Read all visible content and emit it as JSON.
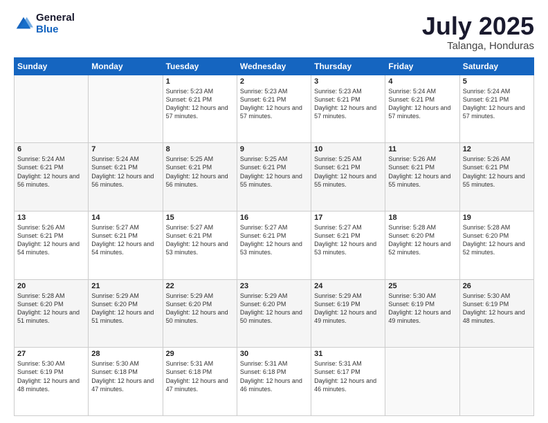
{
  "logo": {
    "general": "General",
    "blue": "Blue"
  },
  "title": "July 2025",
  "location": "Talanga, Honduras",
  "weekdays": [
    "Sunday",
    "Monday",
    "Tuesday",
    "Wednesday",
    "Thursday",
    "Friday",
    "Saturday"
  ],
  "weeks": [
    [
      {
        "day": "",
        "sunrise": "",
        "sunset": "",
        "daylight": ""
      },
      {
        "day": "",
        "sunrise": "",
        "sunset": "",
        "daylight": ""
      },
      {
        "day": "1",
        "sunrise": "Sunrise: 5:23 AM",
        "sunset": "Sunset: 6:21 PM",
        "daylight": "Daylight: 12 hours and 57 minutes."
      },
      {
        "day": "2",
        "sunrise": "Sunrise: 5:23 AM",
        "sunset": "Sunset: 6:21 PM",
        "daylight": "Daylight: 12 hours and 57 minutes."
      },
      {
        "day": "3",
        "sunrise": "Sunrise: 5:23 AM",
        "sunset": "Sunset: 6:21 PM",
        "daylight": "Daylight: 12 hours and 57 minutes."
      },
      {
        "day": "4",
        "sunrise": "Sunrise: 5:24 AM",
        "sunset": "Sunset: 6:21 PM",
        "daylight": "Daylight: 12 hours and 57 minutes."
      },
      {
        "day": "5",
        "sunrise": "Sunrise: 5:24 AM",
        "sunset": "Sunset: 6:21 PM",
        "daylight": "Daylight: 12 hours and 57 minutes."
      }
    ],
    [
      {
        "day": "6",
        "sunrise": "Sunrise: 5:24 AM",
        "sunset": "Sunset: 6:21 PM",
        "daylight": "Daylight: 12 hours and 56 minutes."
      },
      {
        "day": "7",
        "sunrise": "Sunrise: 5:24 AM",
        "sunset": "Sunset: 6:21 PM",
        "daylight": "Daylight: 12 hours and 56 minutes."
      },
      {
        "day": "8",
        "sunrise": "Sunrise: 5:25 AM",
        "sunset": "Sunset: 6:21 PM",
        "daylight": "Daylight: 12 hours and 56 minutes."
      },
      {
        "day": "9",
        "sunrise": "Sunrise: 5:25 AM",
        "sunset": "Sunset: 6:21 PM",
        "daylight": "Daylight: 12 hours and 55 minutes."
      },
      {
        "day": "10",
        "sunrise": "Sunrise: 5:25 AM",
        "sunset": "Sunset: 6:21 PM",
        "daylight": "Daylight: 12 hours and 55 minutes."
      },
      {
        "day": "11",
        "sunrise": "Sunrise: 5:26 AM",
        "sunset": "Sunset: 6:21 PM",
        "daylight": "Daylight: 12 hours and 55 minutes."
      },
      {
        "day": "12",
        "sunrise": "Sunrise: 5:26 AM",
        "sunset": "Sunset: 6:21 PM",
        "daylight": "Daylight: 12 hours and 55 minutes."
      }
    ],
    [
      {
        "day": "13",
        "sunrise": "Sunrise: 5:26 AM",
        "sunset": "Sunset: 6:21 PM",
        "daylight": "Daylight: 12 hours and 54 minutes."
      },
      {
        "day": "14",
        "sunrise": "Sunrise: 5:27 AM",
        "sunset": "Sunset: 6:21 PM",
        "daylight": "Daylight: 12 hours and 54 minutes."
      },
      {
        "day": "15",
        "sunrise": "Sunrise: 5:27 AM",
        "sunset": "Sunset: 6:21 PM",
        "daylight": "Daylight: 12 hours and 53 minutes."
      },
      {
        "day": "16",
        "sunrise": "Sunrise: 5:27 AM",
        "sunset": "Sunset: 6:21 PM",
        "daylight": "Daylight: 12 hours and 53 minutes."
      },
      {
        "day": "17",
        "sunrise": "Sunrise: 5:27 AM",
        "sunset": "Sunset: 6:21 PM",
        "daylight": "Daylight: 12 hours and 53 minutes."
      },
      {
        "day": "18",
        "sunrise": "Sunrise: 5:28 AM",
        "sunset": "Sunset: 6:20 PM",
        "daylight": "Daylight: 12 hours and 52 minutes."
      },
      {
        "day": "19",
        "sunrise": "Sunrise: 5:28 AM",
        "sunset": "Sunset: 6:20 PM",
        "daylight": "Daylight: 12 hours and 52 minutes."
      }
    ],
    [
      {
        "day": "20",
        "sunrise": "Sunrise: 5:28 AM",
        "sunset": "Sunset: 6:20 PM",
        "daylight": "Daylight: 12 hours and 51 minutes."
      },
      {
        "day": "21",
        "sunrise": "Sunrise: 5:29 AM",
        "sunset": "Sunset: 6:20 PM",
        "daylight": "Daylight: 12 hours and 51 minutes."
      },
      {
        "day": "22",
        "sunrise": "Sunrise: 5:29 AM",
        "sunset": "Sunset: 6:20 PM",
        "daylight": "Daylight: 12 hours and 50 minutes."
      },
      {
        "day": "23",
        "sunrise": "Sunrise: 5:29 AM",
        "sunset": "Sunset: 6:20 PM",
        "daylight": "Daylight: 12 hours and 50 minutes."
      },
      {
        "day": "24",
        "sunrise": "Sunrise: 5:29 AM",
        "sunset": "Sunset: 6:19 PM",
        "daylight": "Daylight: 12 hours and 49 minutes."
      },
      {
        "day": "25",
        "sunrise": "Sunrise: 5:30 AM",
        "sunset": "Sunset: 6:19 PM",
        "daylight": "Daylight: 12 hours and 49 minutes."
      },
      {
        "day": "26",
        "sunrise": "Sunrise: 5:30 AM",
        "sunset": "Sunset: 6:19 PM",
        "daylight": "Daylight: 12 hours and 48 minutes."
      }
    ],
    [
      {
        "day": "27",
        "sunrise": "Sunrise: 5:30 AM",
        "sunset": "Sunset: 6:19 PM",
        "daylight": "Daylight: 12 hours and 48 minutes."
      },
      {
        "day": "28",
        "sunrise": "Sunrise: 5:30 AM",
        "sunset": "Sunset: 6:18 PM",
        "daylight": "Daylight: 12 hours and 47 minutes."
      },
      {
        "day": "29",
        "sunrise": "Sunrise: 5:31 AM",
        "sunset": "Sunset: 6:18 PM",
        "daylight": "Daylight: 12 hours and 47 minutes."
      },
      {
        "day": "30",
        "sunrise": "Sunrise: 5:31 AM",
        "sunset": "Sunset: 6:18 PM",
        "daylight": "Daylight: 12 hours and 46 minutes."
      },
      {
        "day": "31",
        "sunrise": "Sunrise: 5:31 AM",
        "sunset": "Sunset: 6:17 PM",
        "daylight": "Daylight: 12 hours and 46 minutes."
      },
      {
        "day": "",
        "sunrise": "",
        "sunset": "",
        "daylight": ""
      },
      {
        "day": "",
        "sunrise": "",
        "sunset": "",
        "daylight": ""
      }
    ]
  ]
}
